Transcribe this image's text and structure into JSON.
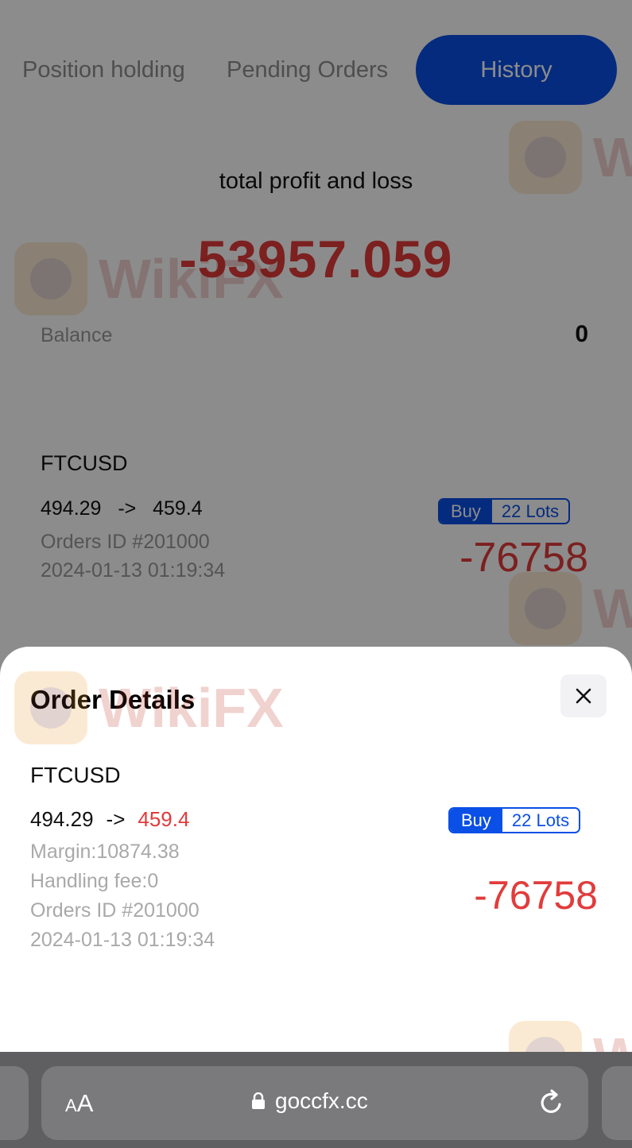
{
  "tabs": {
    "position_holding": "Position holding",
    "pending_orders": "Pending Orders",
    "history": "History"
  },
  "summary": {
    "title": "total profit and loss",
    "value": "-53957.059",
    "balance_label": "Balance",
    "balance_value": "0"
  },
  "history_item": {
    "symbol": "FTCUSD",
    "open_price": "494.29",
    "arrow": "->",
    "close_price": "459.4",
    "side": "Buy",
    "lots": "22 Lots",
    "order_id": "Orders ID #201000",
    "datetime": "2024-01-13 01:19:34",
    "pnl": "-76758"
  },
  "order_details": {
    "title": "Order Details",
    "symbol": "FTCUSD",
    "open_price": "494.29",
    "arrow": "->",
    "close_price": "459.4",
    "side": "Buy",
    "lots": "22 Lots",
    "margin": "Margin:10874.38",
    "handling_fee": "Handling fee:0",
    "order_id": "Orders ID #201000",
    "datetime": "2024-01-13 01:19:34",
    "pnl": "-76758",
    "close_icon": "close-icon"
  },
  "browser": {
    "text_size_small": "A",
    "text_size_big": "A",
    "url": "goccfx.cc",
    "lock_icon": "lock-icon",
    "reload_icon": "reload-icon"
  },
  "watermark": {
    "text": "WikiFX"
  },
  "colors": {
    "accent_blue": "#0a4fe6",
    "loss_red": "#e23b3b",
    "muted_gray": "#a9a9a9"
  }
}
